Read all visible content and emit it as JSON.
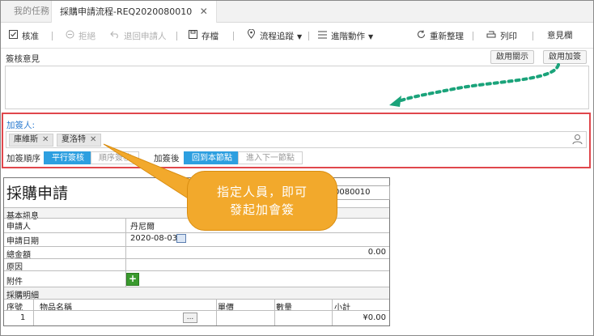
{
  "tabs": {
    "my_tasks": "我的任務",
    "active": "採購申請流程-REQ2020080010",
    "close": "✕"
  },
  "toolbar": {
    "approve": "核准",
    "reject": "拒絕",
    "return_applicant": "退回申請人",
    "save": "存檔",
    "process_trace": "流程追蹤",
    "advanced_actions": "進階動作",
    "reorganize": "重新整理",
    "print": "列印",
    "opinion": "意見欄"
  },
  "opinion": {
    "label": "簽核意見",
    "enable_notify": "啟用關示",
    "enable_countersign": "啟用加簽"
  },
  "countersign": {
    "label": "加簽人:",
    "people": [
      "庫維斯",
      "夏洛特"
    ],
    "order_label": "加簽順序",
    "order_parallel": "平行簽核",
    "order_sequential": "順序簽核",
    "after_label": "加簽後",
    "after_return": "回到本節點",
    "after_next": "進入下一節點"
  },
  "callout": {
    "line1": "指定人員，即可",
    "line2": "發起加會簽"
  },
  "form": {
    "title": "採購申請",
    "request_no_partial": "0080010",
    "basic_info": "基本訊息",
    "applicant_label": "申請人",
    "applicant_value": "丹尼爾",
    "date_label": "申請日期",
    "date_value": "2020-08-03",
    "total_label": "總金額",
    "total_value": "0.00",
    "reason_label": "原因",
    "attachment_label": "附件",
    "attach_plus": "+",
    "detail_section": "採購明細",
    "columns": [
      "序號",
      "物品名稱",
      "單價",
      "數量",
      "小計"
    ],
    "rows": [
      {
        "no": "1",
        "item": "...",
        "price": "",
        "qty": "",
        "subtotal": "¥0.00"
      }
    ]
  },
  "colors": {
    "highlight_border": "#e0474c",
    "accent_blue": "#2d9fe0",
    "callout_orange": "#f2a92c",
    "arrow_green": "#1aa37a"
  }
}
